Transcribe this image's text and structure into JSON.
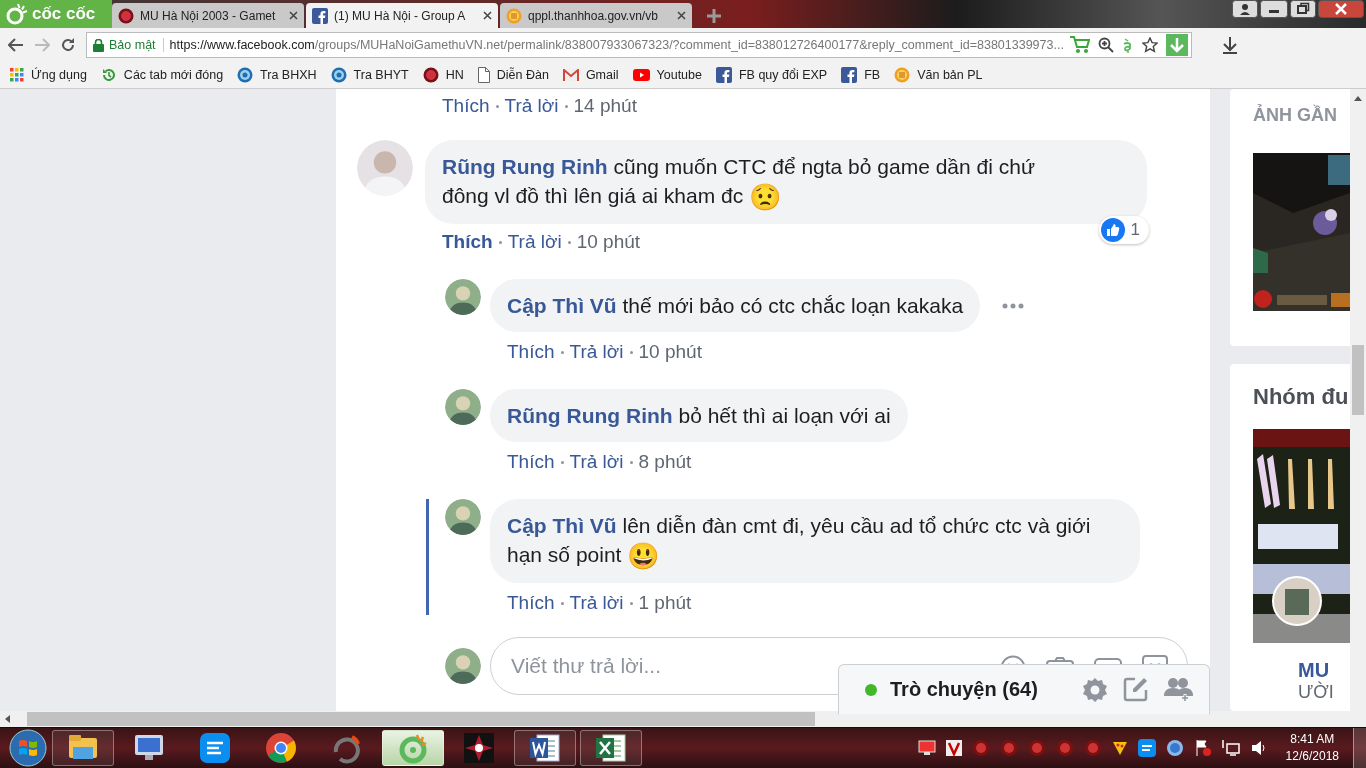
{
  "browser": {
    "logo": "cốc cốc",
    "tabs": [
      {
        "title": "MU Hà Nội 2003 - Gamet",
        "selected": false
      },
      {
        "title": "(1) MU Hà Nội - Group A",
        "selected": true
      },
      {
        "title": "qppl.thanhhoa.gov.vn/vb",
        "selected": false
      }
    ],
    "security_label": "Bảo mật",
    "url_host": "https://www.facebook.com",
    "url_path": "/groups/MUHaNoiGamethuVN.net/permalink/838007933067323/?comment_id=838012726400177&reply_comment_id=83801339973...",
    "bookmarks": [
      "Ứng dụng",
      "Các tab mới đóng",
      "Tra BHXH",
      "Tra BHYT",
      "HN",
      "Diễn Đàn",
      "Gmail",
      "Youtube",
      "FB quy đổi EXP",
      "FB",
      "Văn bản PL"
    ]
  },
  "thread": {
    "previous_actions": {
      "like": "Thích",
      "reply": "Trả lời",
      "time": "14 phút",
      "liked": false
    },
    "comments": [
      {
        "author": "Rũng Rung Rinh",
        "text": "cũng muốn CTC để ngta bỏ game dần đi chứ đông vl đồ thì lên giá ai kham đc",
        "emoji": "😟",
        "like": "Thích",
        "reply": "Trả lời",
        "time": "10 phút",
        "liked": true,
        "reactions": "1",
        "highlighted": false,
        "more_menu": false,
        "replies": [
          {
            "author": "Cập Thì Vũ",
            "text": "thế mới bảo có ctc chắc loạn kakaka",
            "like": "Thích",
            "reply": "Trả lời",
            "time": "10 phút",
            "liked": false,
            "highlighted": false,
            "more_menu": true
          },
          {
            "author": "Rũng Rung Rinh",
            "text": "bỏ hết thì ai loạn với ai",
            "like": "Thích",
            "reply": "Trả lời",
            "time": "8 phút",
            "liked": false,
            "highlighted": false,
            "more_menu": false
          },
          {
            "author": "Cập Thì Vũ",
            "text": "lên diễn đàn cmt đi, yêu cầu ad tổ chức ctc và giới hạn số point",
            "emoji": "😃",
            "like": "Thích",
            "reply": "Trả lời",
            "time": "1 phút",
            "liked": false,
            "highlighted": true,
            "more_menu": false
          }
        ]
      }
    ],
    "reply_box": {
      "placeholder": "Viết thư trả lời..."
    }
  },
  "chat_bar": {
    "label": "Trò chuyện (64)",
    "online": true
  },
  "sidebar": {
    "recent_photos_title": "ẢNH GẦN",
    "groups_title": "Nhóm đu",
    "group_name": "MU",
    "group_meta": "ƯỜI"
  },
  "taskbar": {
    "apps": [
      {
        "kind": "explorer",
        "open": true,
        "selected": false
      },
      {
        "kind": "sc",
        "open": false,
        "selected": false
      },
      {
        "kind": "zalo",
        "open": false,
        "selected": false
      },
      {
        "kind": "chrome",
        "open": false,
        "selected": false
      },
      {
        "kind": "recorder",
        "open": false,
        "selected": false
      },
      {
        "kind": "coccoc",
        "open": true,
        "selected": true
      },
      {
        "kind": "mu",
        "open": false,
        "selected": false
      },
      {
        "kind": "word",
        "open": true,
        "selected": false
      },
      {
        "kind": "excel",
        "open": true,
        "selected": false
      }
    ],
    "time": "8:41 AM",
    "date": "12/6/2018"
  }
}
